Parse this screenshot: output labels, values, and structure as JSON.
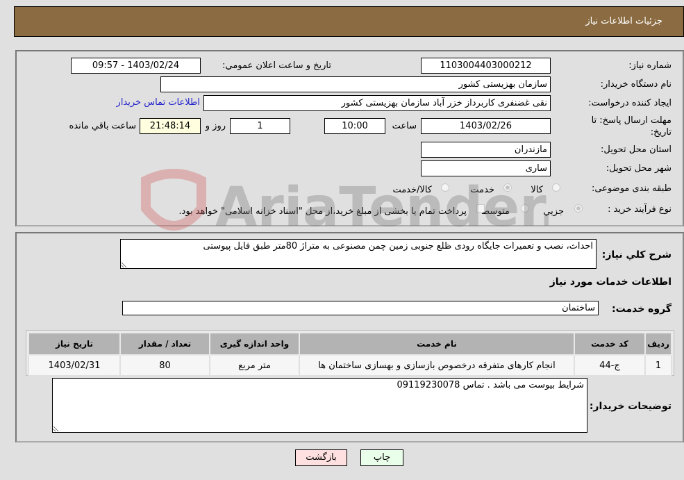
{
  "header": {
    "title": "جزئیات اطلاعات نیاز"
  },
  "form": {
    "need_number": {
      "label": "شماره نیاز:",
      "value": "1103004403000212"
    },
    "announce_datetime": {
      "label": "تاریخ و ساعت اعلان عمومي:",
      "value": "1403/02/24 - 09:57"
    },
    "buyer_org": {
      "label": "نام دستگاه خريدار:",
      "value": "سازمان بهزیستی کشور"
    },
    "requester": {
      "label": "ایجاد کننده درخواست:",
      "value": "نقی غضنفری کاربرداز خزر آباد سازمان بهزیستی کشور"
    },
    "buyer_contact_link": "اطلاعات تماس خريدار",
    "deadline": {
      "label_line1": "مهلت ارسال پاسخ: تا",
      "label_line2": "تاریخ:",
      "date": "1403/02/26",
      "time_label": "ساعت",
      "time": "10:00",
      "days": "1",
      "days_label": "روز و",
      "remaining": "21:48:14",
      "remaining_label": "ساعت باقي مانده"
    },
    "province": {
      "label": "استان محل تحویل:",
      "value": "مازندران"
    },
    "city": {
      "label": "شهر محل تحویل:",
      "value": "ساری"
    },
    "category": {
      "label": "طبقه بندی موضوعی:",
      "options": [
        {
          "label": "کالا",
          "selected": false
        },
        {
          "label": "خدمت",
          "selected": true
        },
        {
          "label": "کالا/خدمت",
          "selected": false
        }
      ]
    },
    "purchase_type": {
      "label": "نوع فرآیند خرید :",
      "options": [
        {
          "label": "جزيي",
          "selected": true
        },
        {
          "label": "متوسط",
          "selected": false
        }
      ],
      "checkbox_label": "پرداخت تمام یا بخشی از مبلغ خرید،از محل \"اسناد خزانه اسلامی\" خواهد بود.",
      "checkbox_checked": false
    }
  },
  "details": {
    "description_label": "شرح کلي نياز:",
    "description": "احداث، نصب و تعمیرات جایگاه رودی ظلع جنوبی زمین چمن مصنوعی به متراژ 80متر طبق فایل پیوستی",
    "services_heading": "اطلاعات خدمات مورد نياز",
    "service_group_label": "گروه خدمت:",
    "service_group": "ساختمان",
    "table": {
      "headers": [
        "رديف",
        "کد خدمت",
        "نام خدمت",
        "واحد اندازه گیری",
        "تعداد / مقدار",
        "تاريخ نياز"
      ],
      "rows": [
        [
          "1",
          "ج-44",
          "انجام کارهای متفرقه درخصوص بازسازی و بهسازی ساختمان ها",
          "متر مربع",
          "80",
          "1403/02/31"
        ]
      ]
    },
    "buyer_notes_label": "توضیحات خریدار:",
    "buyer_notes": "شرایط بیوست می باشد . تماس 09119230078"
  },
  "buttons": {
    "print": "چاپ",
    "back": "بازگشت"
  },
  "watermark": {
    "text": "AriaTender.net"
  }
}
